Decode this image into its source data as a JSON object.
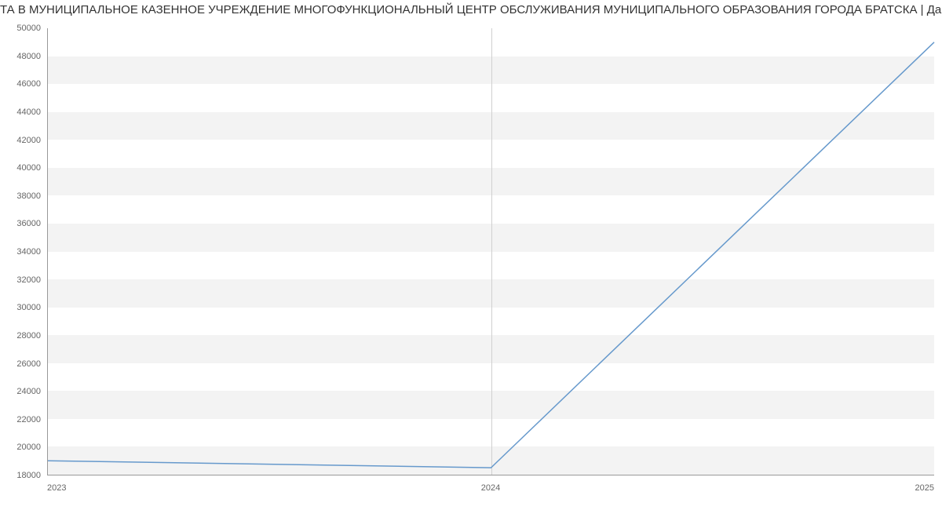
{
  "title": "ТА В МУНИЦИПАЛЬНОЕ КАЗЕННОЕ УЧРЕЖДЕНИЕ МНОГОФУНКЦИОНАЛЬНЫЙ ЦЕНТР ОБСЛУЖИВАНИЯ МУНИЦИПАЛЬНОГО ОБРАЗОВАНИЯ ГОРОДА БРАТСКА | Данные mno",
  "chart_data": {
    "type": "line",
    "x": [
      2023,
      2024,
      2025
    ],
    "values": [
      19000,
      18500,
      49000
    ],
    "title": "ТА В МУНИЦИПАЛЬНОЕ КАЗЕННОЕ УЧРЕЖДЕНИЕ МНОГОФУНКЦИОНАЛЬНЫЙ ЦЕНТР ОБСЛУЖИВАНИЯ МУНИЦИПАЛЬНОГО ОБРАЗОВАНИЯ ГОРОДА БРАТСКА | Данные mno",
    "xlabel": "",
    "ylabel": "",
    "xlim": [
      2023,
      2025
    ],
    "ylim": [
      18000,
      50000
    ],
    "y_ticks": [
      18000,
      20000,
      22000,
      24000,
      26000,
      28000,
      30000,
      32000,
      34000,
      36000,
      38000,
      40000,
      42000,
      44000,
      46000,
      48000,
      50000
    ],
    "x_ticks": [
      2023,
      2024,
      2025
    ],
    "line_color": "#6699cc"
  }
}
